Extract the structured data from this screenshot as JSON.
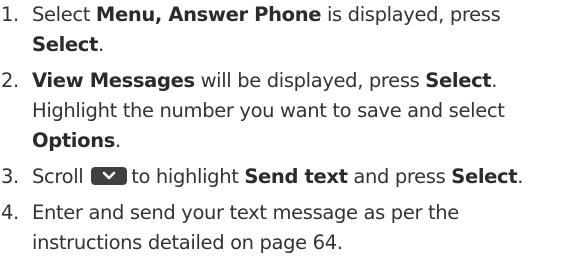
{
  "steps": [
    {
      "number": "1.",
      "lines": [
        [
          "Select ",
          "Menu, Answer Phone",
          " is displayed, press"
        ],
        [
          "Select",
          "."
        ]
      ]
    },
    {
      "number": "2.",
      "lines": [
        [
          "View Messages",
          " will be displayed, press ",
          "Select",
          "."
        ],
        [
          "Highlight the number you want to save and select"
        ],
        [
          "Options",
          "."
        ]
      ]
    },
    {
      "number": "3.",
      "lines": [
        [
          "Scroll ",
          "to highlight ",
          "Send text",
          " and press ",
          "Select",
          "."
        ]
      ],
      "icon": "scroll-down-key-icon"
    },
    {
      "number": "4.",
      "lines": [
        [
          "Enter and send your text message as per the"
        ],
        [
          "instructions detailed on page 64."
        ]
      ]
    }
  ]
}
